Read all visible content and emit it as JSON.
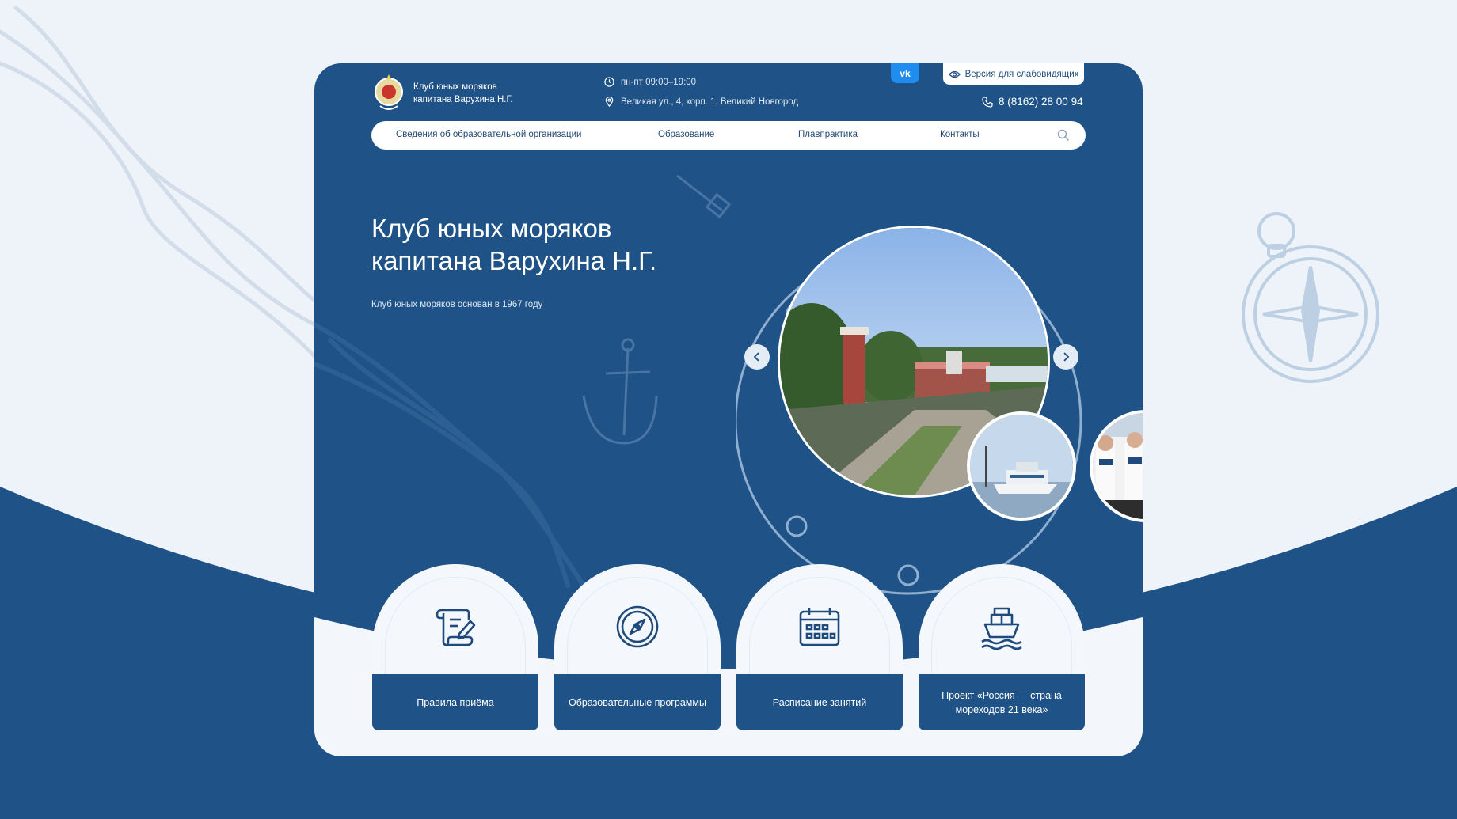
{
  "brand": {
    "line1": "Клуб юных моряков",
    "line2": "капитана Варухина Н.Г."
  },
  "header": {
    "hours": "пн-пт 09:00–19:00",
    "address": "Великая ул., 4, корп. 1, Великий Новгород",
    "vk_label": "vk",
    "accessibility_label": "Версия для слабовидящих",
    "phone": "8 (8162) 28 00 94"
  },
  "nav": {
    "items": [
      {
        "label": "Сведения об образовательной организации"
      },
      {
        "label": "Образование"
      },
      {
        "label": "Плавпрактика"
      },
      {
        "label": "Контакты"
      }
    ]
  },
  "hero": {
    "title_line1": "Клуб юных моряков",
    "title_line2": "капитана Варухина Н.Г.",
    "subtitle": "Клуб юных моряков основан в 1967 году"
  },
  "tiles": [
    {
      "label": "Правила приёма",
      "icon": "scroll-pen-icon"
    },
    {
      "label": "Образовательные программы",
      "icon": "compass-icon"
    },
    {
      "label": "Расписание занятий",
      "icon": "calendar-icon"
    },
    {
      "label": "Проект «Россия — страна мореходов 21 века»",
      "icon": "ship-icon"
    }
  ],
  "colors": {
    "primary": "#1f5287",
    "background": "#eef3fa",
    "vk": "#1f8cf0",
    "tile_bg": "#f4f8fd"
  }
}
